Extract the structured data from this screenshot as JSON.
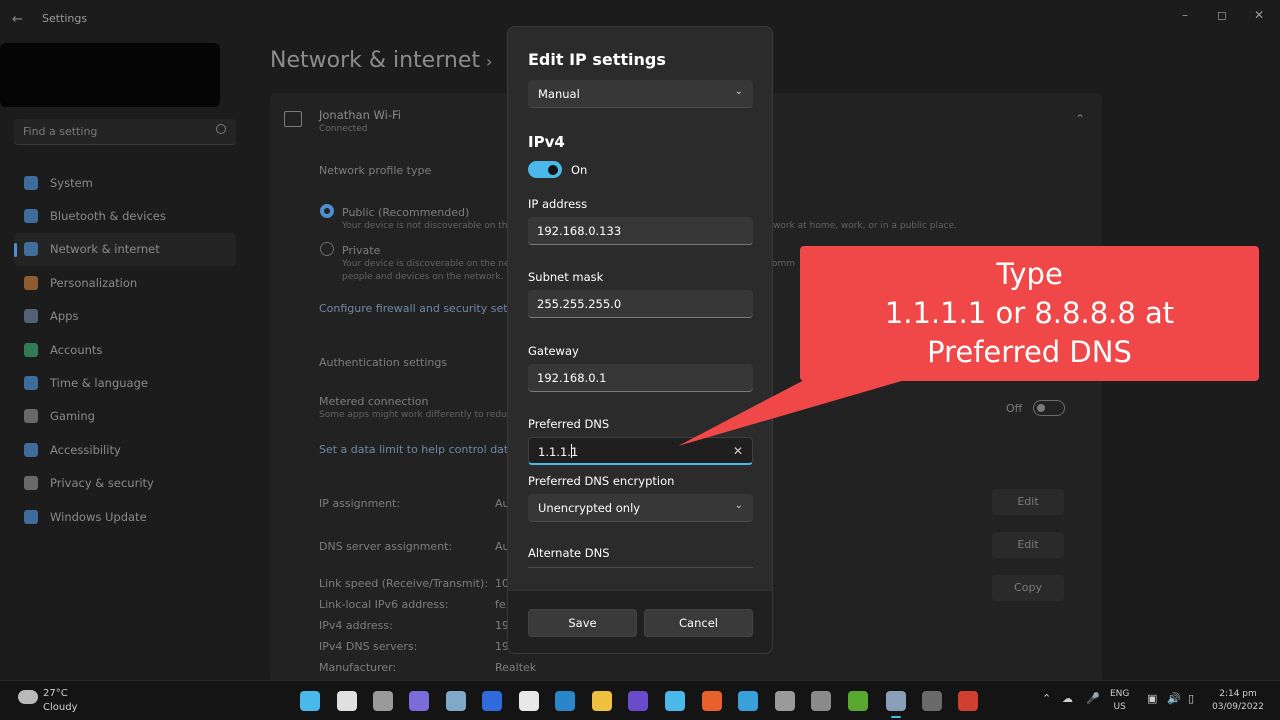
{
  "window": {
    "title": "Settings",
    "back_icon": "back-arrow-icon",
    "controls": [
      "minimize-icon",
      "maximize-icon",
      "close-icon"
    ]
  },
  "search": {
    "placeholder": "Find a setting"
  },
  "nav": [
    {
      "label": "System",
      "icon": "system-icon",
      "color": "#4d8fd1"
    },
    {
      "label": "Bluetooth & devices",
      "icon": "bluetooth-icon",
      "color": "#4d8fd1"
    },
    {
      "label": "Network & internet",
      "icon": "network-icon",
      "color": "#4d8fd1",
      "active": true
    },
    {
      "label": "Personalization",
      "icon": "brush-icon",
      "color": "#c0783c"
    },
    {
      "label": "Apps",
      "icon": "apps-icon",
      "color": "#6a7f9a"
    },
    {
      "label": "Accounts",
      "icon": "accounts-icon",
      "color": "#3aa36b"
    },
    {
      "label": "Time & language",
      "icon": "time-icon",
      "color": "#4d8fd1"
    },
    {
      "label": "Gaming",
      "icon": "gaming-icon",
      "color": "#8a8a8a"
    },
    {
      "label": "Accessibility",
      "icon": "accessibility-icon",
      "color": "#4d8fd1"
    },
    {
      "label": "Privacy & security",
      "icon": "shield-icon",
      "color": "#8a8a8a"
    },
    {
      "label": "Windows Update",
      "icon": "update-icon",
      "color": "#4d8fd1"
    }
  ],
  "page": {
    "title": "Network & internet",
    "wifi_name": "Jonathan Wi-Fi",
    "wifi_status": "Connected",
    "profile_type": "Network profile type",
    "public_label": "Public (Recommended)",
    "public_desc": "Your device is not discoverable on th",
    "public_desc2": "etwork at home, work, or in a public place.",
    "private_label": "Private",
    "private_desc": "Your device is discoverable on the ne",
    "private_desc_right": "omm",
    "private_desc2": "people and devices on the network.",
    "firewall_link": "Configure firewall and security setti",
    "auth": "Authentication settings",
    "metered": "Metered connection",
    "metered_desc": "Some apps might work differently to redu",
    "metered_state": "Off",
    "data_limit_link": "Set a data limit to help control data u",
    "ip_assignment": "IP assignment:",
    "ip_assignment_val": "Au",
    "dns_assignment": "DNS server assignment:",
    "dns_assignment_val": "Au",
    "link_speed": "Link speed (Receive/Transmit):",
    "link_speed_val": "10",
    "ipv6": "Link-local IPv6 address:",
    "ipv6_val": "fe",
    "ipv4": "IPv4 address:",
    "ipv4_val": "19",
    "ipv4_dns": "IPv4 DNS servers:",
    "ipv4_dns_val": "19",
    "manufacturer": "Manufacturer:",
    "manufacturer_val": "Realtek",
    "edit1": "Edit",
    "edit2": "Edit",
    "copy": "Copy"
  },
  "dialog": {
    "title": "Edit IP settings",
    "mode": "Manual",
    "section": "IPv4",
    "toggle_label": "On",
    "ip_label": "IP address",
    "ip_value": "192.168.0.133",
    "subnet_label": "Subnet mask",
    "subnet_value": "255.255.255.0",
    "gateway_label": "Gateway",
    "gateway_value": "192.168.0.1",
    "dns_label": "Preferred DNS",
    "dns_value": "1.1.1.1",
    "enc_label": "Preferred DNS encryption",
    "enc_value": "Unencrypted only",
    "alt_dns_label": "Alternate DNS",
    "save": "Save",
    "cancel": "Cancel"
  },
  "callout": {
    "line1": "Type",
    "line2": "1.1.1.1 or 8.8.8.8 at",
    "line3": "Preferred DNS",
    "color": "#f04848"
  },
  "taskbar": {
    "temp": "27°C",
    "condition": "Cloudy",
    "lang1": "ENG",
    "lang2": "US",
    "time": "2:14 pm",
    "date": "03/09/2022",
    "apps": [
      {
        "icon": "windows-start-icon",
        "color": "#4ab8e8"
      },
      {
        "icon": "search-icon",
        "color": "#e0e0e0"
      },
      {
        "icon": "task-view-icon",
        "color": "#9a9a9a"
      },
      {
        "icon": "chat-icon",
        "color": "#7b6cd9"
      },
      {
        "icon": "photos-icon",
        "color": "#7fa8c9"
      },
      {
        "icon": "ip-icon",
        "color": "#2f6bdc"
      },
      {
        "icon": "store-icon",
        "color": "#e8e8e8"
      },
      {
        "icon": "photoshop-icon",
        "color": "#2a86c9"
      },
      {
        "icon": "folder-icon",
        "color": "#f0c040"
      },
      {
        "icon": "premiere-icon",
        "color": "#6a4bc9"
      },
      {
        "icon": "notepad-icon",
        "color": "#4ab8e8"
      },
      {
        "icon": "brave-icon",
        "color": "#e8602c"
      },
      {
        "icon": "app-icon",
        "color": "#3aa0d9"
      },
      {
        "icon": "obs-icon",
        "color": "#9a9a9a"
      },
      {
        "icon": "calculator-icon",
        "color": "#8a8a8a"
      },
      {
        "icon": "camtasia-icon",
        "color": "#5aa830"
      },
      {
        "icon": "settings-icon",
        "color": "#8aa0b8",
        "active": true
      },
      {
        "icon": "terminal-icon",
        "color": "#6a6a6a"
      },
      {
        "icon": "recorder-icon",
        "color": "#d04030"
      }
    ]
  }
}
